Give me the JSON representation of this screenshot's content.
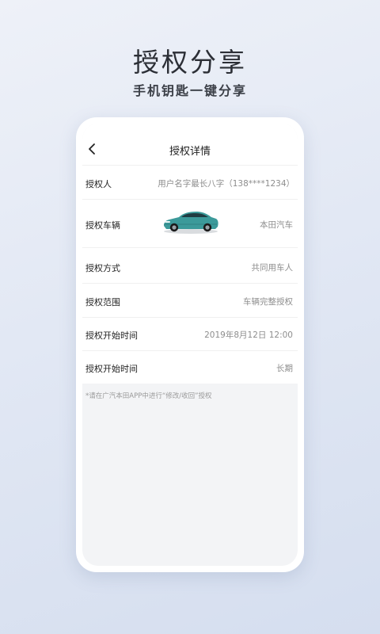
{
  "hero": {
    "title": "授权分享",
    "subtitle": "手机钥匙一键分享"
  },
  "nav": {
    "back_icon": "chevron-left-icon",
    "title": "授权详情"
  },
  "rows": [
    {
      "label": "授权人",
      "value": "用户名字最长八字（138****1234）"
    },
    {
      "label": "授权车辆",
      "value": "本田汽车",
      "image": "teal-sedan"
    },
    {
      "label": "授权方式",
      "value": "共同用车人"
    },
    {
      "label": "授权范围",
      "value": "车辆完整授权"
    },
    {
      "label": "授权开始时间",
      "value": "2019年8月12日  12:00"
    },
    {
      "label": "授权开始时间",
      "value": "长期"
    }
  ],
  "footnote": "*请在广汽本田APP中进行“修改/收回”授权",
  "colors": {
    "car_body": "#3c9a9a",
    "background_top": "#eef1f8",
    "background_bottom": "#d5deef"
  }
}
